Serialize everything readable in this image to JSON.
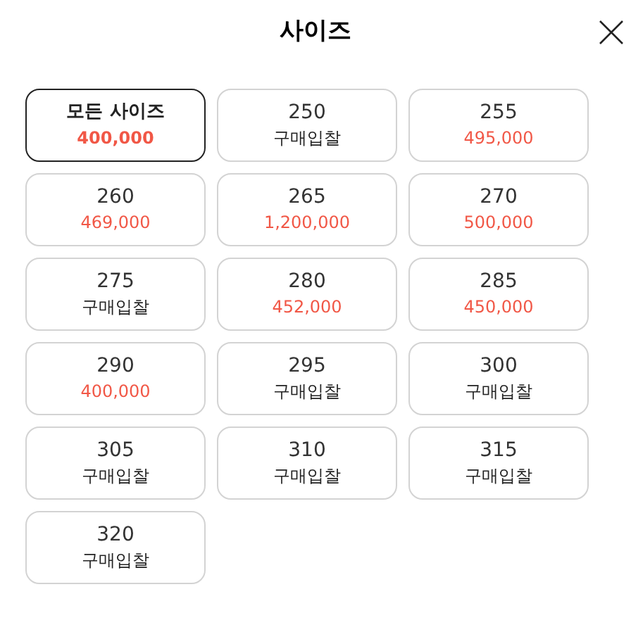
{
  "title": "사이즈",
  "sizes": [
    {
      "label": "모든 사이즈",
      "sub": "400,000",
      "kind": "price",
      "selected": true
    },
    {
      "label": "250",
      "sub": "구매입찰",
      "kind": "bid",
      "selected": false
    },
    {
      "label": "255",
      "sub": "495,000",
      "kind": "price",
      "selected": false
    },
    {
      "label": "260",
      "sub": "469,000",
      "kind": "price",
      "selected": false
    },
    {
      "label": "265",
      "sub": "1,200,000",
      "kind": "price",
      "selected": false
    },
    {
      "label": "270",
      "sub": "500,000",
      "kind": "price",
      "selected": false
    },
    {
      "label": "275",
      "sub": "구매입찰",
      "kind": "bid",
      "selected": false
    },
    {
      "label": "280",
      "sub": "452,000",
      "kind": "price",
      "selected": false
    },
    {
      "label": "285",
      "sub": "450,000",
      "kind": "price",
      "selected": false
    },
    {
      "label": "290",
      "sub": "400,000",
      "kind": "price",
      "selected": false
    },
    {
      "label": "295",
      "sub": "구매입찰",
      "kind": "bid",
      "selected": false
    },
    {
      "label": "300",
      "sub": "구매입찰",
      "kind": "bid",
      "selected": false
    },
    {
      "label": "305",
      "sub": "구매입찰",
      "kind": "bid",
      "selected": false
    },
    {
      "label": "310",
      "sub": "구매입찰",
      "kind": "bid",
      "selected": false
    },
    {
      "label": "315",
      "sub": "구매입찰",
      "kind": "bid",
      "selected": false
    },
    {
      "label": "320",
      "sub": "구매입찰",
      "kind": "bid",
      "selected": false
    }
  ]
}
